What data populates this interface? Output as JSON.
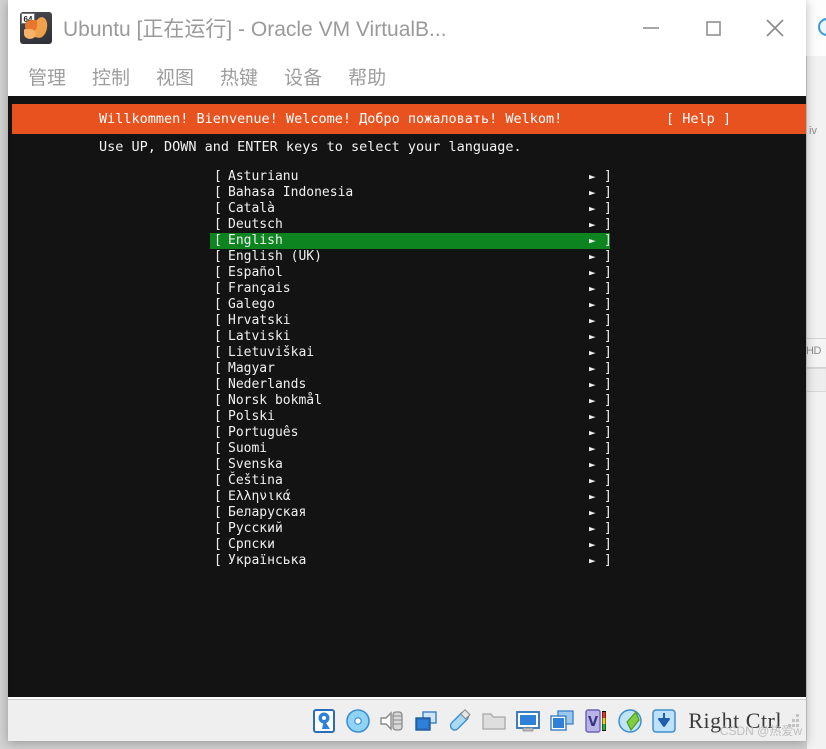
{
  "window": {
    "title": "Ubuntu [正在运行] - Oracle VM VirtualB...",
    "icon_badge": "64",
    "controls": {
      "minimize": "minimize-button",
      "maximize": "maximize-button",
      "close": "close-button"
    }
  },
  "menubar": {
    "items": [
      {
        "label": "管理"
      },
      {
        "label": "控制"
      },
      {
        "label": "视图"
      },
      {
        "label": "热键"
      },
      {
        "label": "设备"
      },
      {
        "label": "帮助"
      }
    ]
  },
  "installer": {
    "banner": {
      "welcome": "Willkommen! Bienvenue! Welcome! Добро пожаловать! Welkom!",
      "help": "[ Help ]",
      "background_color": "#e8521f",
      "text_color": "#ffffff"
    },
    "instruction": "Use UP, DOWN and ENTER keys to select your language.",
    "selected_language": "English",
    "highlight_color": "#0e8420",
    "bracket_left": "[",
    "bracket_right": "]",
    "arrow": "►",
    "languages": [
      {
        "name": "Asturianu"
      },
      {
        "name": "Bahasa Indonesia"
      },
      {
        "name": "Català"
      },
      {
        "name": "Deutsch"
      },
      {
        "name": "English"
      },
      {
        "name": "English (UK)"
      },
      {
        "name": "Español"
      },
      {
        "name": "Français"
      },
      {
        "name": "Galego"
      },
      {
        "name": "Hrvatski"
      },
      {
        "name": "Latviski"
      },
      {
        "name": "Lietuviškai"
      },
      {
        "name": "Magyar"
      },
      {
        "name": "Nederlands"
      },
      {
        "name": "Norsk bokmål"
      },
      {
        "name": "Polski"
      },
      {
        "name": "Português"
      },
      {
        "name": "Suomi"
      },
      {
        "name": "Svenska"
      },
      {
        "name": "Čeština"
      },
      {
        "name": "Ελληνικά"
      },
      {
        "name": "Беларуская"
      },
      {
        "name": "Русский"
      },
      {
        "name": "Српски"
      },
      {
        "name": "Українська"
      }
    ]
  },
  "statusbar": {
    "icons": [
      {
        "name": "hard-disk-icon"
      },
      {
        "name": "optical-drive-icon"
      },
      {
        "name": "audio-icon"
      },
      {
        "name": "network-icon"
      },
      {
        "name": "usb-icon"
      },
      {
        "name": "shared-folders-icon"
      },
      {
        "name": "display-icon"
      },
      {
        "name": "recording-icon"
      },
      {
        "name": "virtualization-icon"
      },
      {
        "name": "mouse-integration-icon"
      },
      {
        "name": "keyboard-capture-icon"
      }
    ],
    "host_key_label": "Right Ctrl"
  },
  "background": {
    "fragment_1": "iv",
    "fragment_2": "HD"
  },
  "watermark": "CSDN @热爱w"
}
